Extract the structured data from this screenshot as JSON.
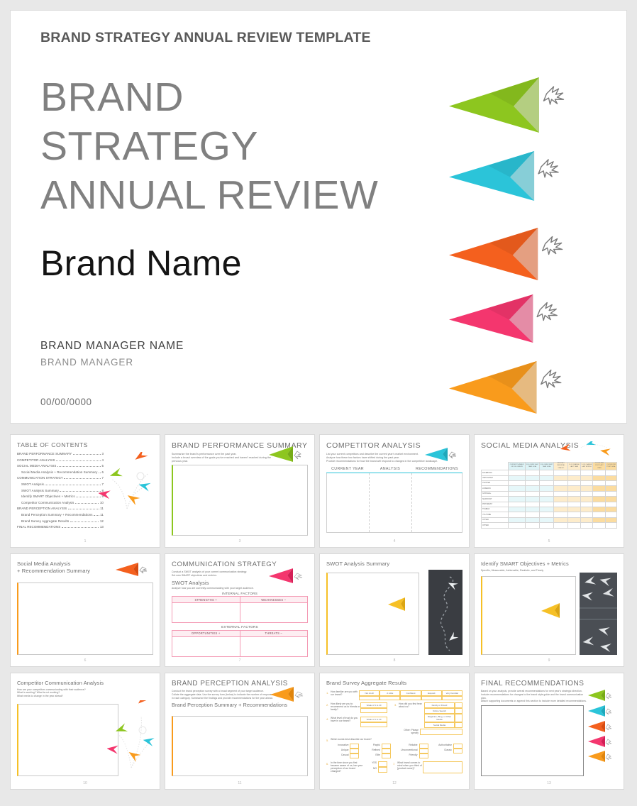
{
  "cover": {
    "kicker": "BRAND STRATEGY ANNUAL REVIEW TEMPLATE",
    "title_line1": "BRAND",
    "title_line2": "STRATEGY",
    "title_line3": "ANNUAL REVIEW",
    "brand_name": "Brand Name",
    "manager_name": "BRAND MANAGER NAME",
    "manager_role": "BRAND MANAGER",
    "date": "00/00/0000"
  },
  "colors": {
    "green": "#8DC61F",
    "cyan": "#2BC4D9",
    "orange_red": "#F4601E",
    "pink": "#F4366E",
    "amber": "#F99B1C",
    "title_gray": "#808080",
    "kicker_gray": "#595959"
  },
  "planes": [
    {
      "name": "paper-plane-green",
      "color": "#8DC61F"
    },
    {
      "name": "paper-plane-cyan",
      "color": "#2BC4D9"
    },
    {
      "name": "paper-plane-orange-red",
      "color": "#F4601E"
    },
    {
      "name": "paper-plane-pink",
      "color": "#F4366E"
    },
    {
      "name": "paper-plane-amber",
      "color": "#F99B1C"
    }
  ],
  "toc": {
    "title": "TABLE OF CONTENTS",
    "page_number": "1",
    "entries": [
      {
        "label": "BRAND PERFORMANCE SUMMARY",
        "page": "3",
        "indent": false
      },
      {
        "label": "COMPETITOR ANALYSIS",
        "page": "4",
        "indent": false
      },
      {
        "label": "SOCIAL MEDIA ANALYSIS",
        "page": "5",
        "indent": false
      },
      {
        "label": "Social Media Analysis  + Recommendation Summary",
        "page": "6",
        "indent": true
      },
      {
        "label": "COMMUNICATION STRATEGY",
        "page": "7",
        "indent": false
      },
      {
        "label": "SWOT Analysis",
        "page": "7",
        "indent": true
      },
      {
        "label": "SWOT Analysis Summary",
        "page": "8",
        "indent": true
      },
      {
        "label": "Identify SMART Objectives + Metrics",
        "page": "9",
        "indent": true
      },
      {
        "label": "Competitor Communication Analysis",
        "page": "10",
        "indent": true
      },
      {
        "label": "BRAND PERCEPTION ANALYSIS",
        "page": "11",
        "indent": false
      },
      {
        "label": "Brand Perception Summary + Recommendations",
        "page": "11",
        "indent": true
      },
      {
        "label": "Brand Survey Aggregate Results",
        "page": "12",
        "indent": true
      },
      {
        "label": "FINAL RECOMMENDATIONS",
        "page": "13",
        "indent": false
      }
    ]
  },
  "slides": {
    "brand_performance": {
      "title": "BRAND PERFORMANCE SUMMARY",
      "desc1": "Summarize the brand's performance over the past year.",
      "desc2": "Include a broad overview of the goals you've reached and haven't reached during the previous year.",
      "page_number": "3",
      "accent": "#8DC61F"
    },
    "competitor_analysis": {
      "title": "COMPETITOR ANALYSIS",
      "desc1": "List your current competitors and describe the current year's market environment.",
      "desc2": "Analyze how these two factors have shifted during the past year.",
      "desc3": "Provide recommendations for how the brand will respond to changes in the competitive landscape.",
      "columns": [
        "CURRENT YEAR",
        "ANALYSIS",
        "RECOMMENDATIONS"
      ],
      "page_number": "4",
      "accent": "#2BC4D9"
    },
    "social_media": {
      "title": "SOCIAL MEDIA ANALYSIS",
      "page_number": "5",
      "columns": [
        "CURRENT NUMBER OF FOLLOWERS",
        "FOLLOWER LAST YEAR GOAL",
        "FOLLOWER NEXT YEAR GOAL",
        "MONTHLY REFERRAL TRAFFIC",
        "% OF CHANGE LAST YEAR",
        "% OF CHANGE LAST MONTH",
        "CLICKS PER POST LAST YEAR",
        "CLICKS PER POST GOAL"
      ],
      "rows": [
        "FACEBOOK",
        "INSTAGRAM",
        "TWITTER",
        "LINKEDIN",
        "GOOGLE+",
        "SNAPCHAT",
        "PINTEREST",
        "TUMBLR",
        "YOUTUBE",
        "OTHER",
        "OTHER"
      ]
    },
    "social_media_summary": {
      "title_line1": "Social Media Analysis",
      "title_line2": "+ Recommendation Summary",
      "page_number": "6",
      "accent": "#F99B1C"
    },
    "communication_strategy": {
      "title": "COMMUNICATION STRATEGY",
      "desc1": "Conduct a SWOT analysis of your current communication strategy.",
      "desc2": "Set new SMART objectives and metrics.",
      "subtitle": "SWOT Analysis",
      "desc3": "Analyze how you are currently communicating with your target audience.",
      "internal_caption": "INTERNAL FACTORS",
      "external_caption": "EXTERNAL FACTORS",
      "strengths": "STRENGTHS  +",
      "weaknesses": "WEAKNESSES  –",
      "opportunities": "OPPORTUNITIES  +",
      "threats": "THREATS  –",
      "page_number": "7",
      "accent": "#F4366E"
    },
    "swot_summary": {
      "title": "SWOT Analysis Summary",
      "page_number": "8",
      "accent": "#F6C026"
    },
    "smart_objectives": {
      "title": "Identify SMART Objectives + Metrics",
      "desc1": "Specific, Measurable, Achievable, Realistic, and Timely",
      "page_number": "9",
      "accent": "#F6C026"
    },
    "competitor_communication": {
      "title": "Competitor Communication Analysis",
      "desc1": "How are your competitors communicating with their audience?",
      "desc2": "What is working? What is not working?",
      "desc3": "What needs to change in the year ahead?",
      "page_number": "10",
      "accent": "#F6C026"
    },
    "brand_perception": {
      "title": "BRAND PERCEPTION ANALYSIS",
      "desc1": "Conduct the brand perception survey with a broad segment of your target audience.",
      "desc2": "Collate the aggregate data. Use the survey form (below) to indicate the number of responses",
      "desc3": "in each category. Summarize the findings and provide recommendations for the year ahead.",
      "subtitle": "Brand Perception Summary + Recommendations",
      "page_number": "11",
      "accent": "#F99B1C"
    },
    "brand_survey": {
      "title": "Brand Survey Aggregate Results",
      "page_number": "12",
      "q1": {
        "num": "1.",
        "text": "How familiar are you with our brand?",
        "options": [
          "Not At All",
          "A Little",
          "Confident",
          "Exquisit",
          "Very Familiar"
        ]
      },
      "q2": {
        "num": "2.",
        "text": "How likely are you to recommend us to friends or family?",
        "label": "Scale of 1 to 10"
      },
      "q3": {
        "num": "3.",
        "text": "How did you first hear about us?",
        "options": [
          "Family or Friend",
          "Online Search",
          "Magazine, Blog, or Other Media",
          "Social Media"
        ],
        "other": "Other: Please specify"
      },
      "q4": {
        "num": "4.",
        "text": "What level of trust do you have in our brand?",
        "label": "Scale of 1 to 10"
      },
      "q5": {
        "num": "5.",
        "text": "Which words best describe our brand?",
        "options": [
          "Innovative",
          "Unique",
          "Casual",
          "Playful",
          "Refined",
          "Elite",
          "Reliable",
          "Unconventional",
          "Friendly",
          "Authoritative",
          "Classic",
          "Other"
        ]
      },
      "q6": {
        "num": "6.",
        "text": "In the time since you first became aware of us, has your perception of our brand changed?",
        "options": [
          "YES",
          "NO"
        ]
      },
      "q7": {
        "num": "7.",
        "text": "What brand comes to mind when you think of [product name]?"
      }
    },
    "final_recommendations": {
      "title": "FINAL RECOMMENDATIONS",
      "desc1": "Based on your analysis, provide overall recommendations for next year's strategic direction.",
      "desc2": "Include recommendations for changes to the brand style guide and the brand communication plan.",
      "desc3": "Attach supporting documents or append this section to include more detailed recommendations.",
      "page_number": "13"
    }
  }
}
